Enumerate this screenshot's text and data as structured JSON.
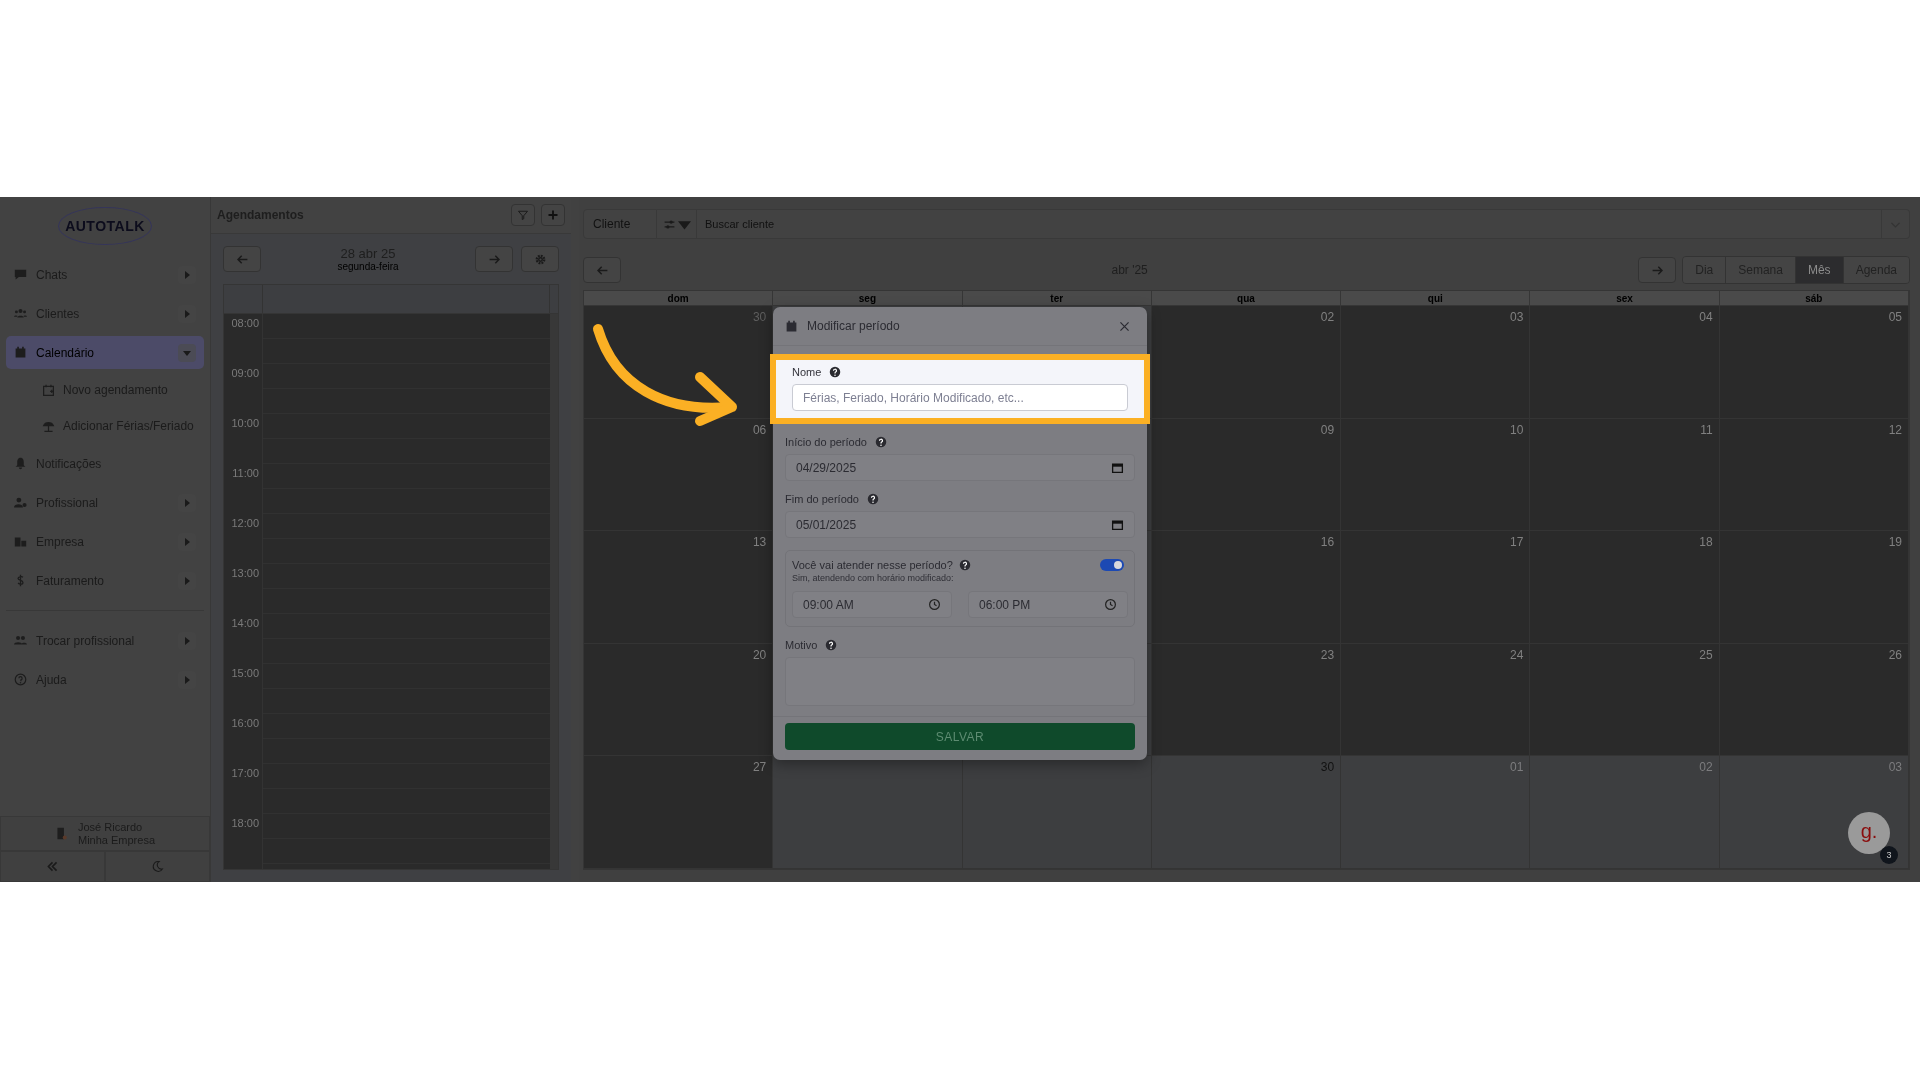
{
  "sidebar": {
    "logo": "AUTOTALK",
    "items": [
      {
        "label": "Chats",
        "kind": "group",
        "expanded": false,
        "selected": false
      },
      {
        "label": "Clientes",
        "kind": "group",
        "expanded": false,
        "selected": false
      },
      {
        "label": "Calendário",
        "kind": "group",
        "expanded": true,
        "selected": true,
        "children": [
          {
            "label": "Novo agendamento",
            "selected": false
          },
          {
            "label": "Adicionar Férias/Feriado",
            "selected": false
          }
        ]
      },
      {
        "label": "Notificações",
        "kind": "link",
        "selected": false
      },
      {
        "label": "Profissional",
        "kind": "group",
        "expanded": false,
        "selected": false
      },
      {
        "label": "Empresa",
        "kind": "group",
        "expanded": false,
        "selected": false
      },
      {
        "label": "Faturamento",
        "kind": "group",
        "expanded": false,
        "selected": false
      }
    ],
    "secondary_items": [
      {
        "label": "Trocar profissional",
        "kind": "group",
        "expanded": false,
        "selected": false
      },
      {
        "label": "Ajuda",
        "kind": "group",
        "expanded": false,
        "selected": false
      }
    ],
    "user": {
      "name": "José Ricardo",
      "company": "Minha Empresa"
    }
  },
  "schedule": {
    "title": "Agendamentos",
    "date": "28 abr 25",
    "weekday": "segunda-feira",
    "hours": [
      "08:00",
      "09:00",
      "10:00",
      "11:00",
      "12:00",
      "13:00",
      "14:00",
      "15:00",
      "16:00",
      "17:00",
      "18:00"
    ]
  },
  "calendar": {
    "search": {
      "filter": "Cliente",
      "placeholder": "Buscar cliente"
    },
    "month": "abr '25",
    "views": [
      {
        "label": "Dia",
        "selected": false
      },
      {
        "label": "Semana",
        "selected": false
      },
      {
        "label": "Mês",
        "selected": true
      },
      {
        "label": "Agenda",
        "selected": false
      }
    ],
    "weekdays": [
      "dom",
      "seg",
      "ter",
      "qua",
      "qui",
      "sex",
      "sáb"
    ],
    "weeks": [
      {
        "sun": {
          "day": "30",
          "past": true,
          "other_month": true
        },
        "wed": {
          "day": "02",
          "past": true,
          "other_month": false
        },
        "thu": {
          "day": "03",
          "past": true,
          "other_month": false
        },
        "fri": {
          "day": "04",
          "past": true,
          "other_month": false
        },
        "sat": {
          "day": "05",
          "past": true,
          "other_month": false
        }
      },
      {
        "sun": {
          "day": "06",
          "past": true,
          "other_month": false
        },
        "wed": {
          "day": "09",
          "past": true,
          "other_month": false
        },
        "thu": {
          "day": "10",
          "past": true,
          "other_month": false
        },
        "fri": {
          "day": "11",
          "past": true,
          "other_month": false
        },
        "sat": {
          "day": "12",
          "past": true,
          "other_month": false
        }
      },
      {
        "sun": {
          "day": "13",
          "past": true,
          "other_month": false
        },
        "wed": {
          "day": "16",
          "past": true,
          "other_month": false
        },
        "thu": {
          "day": "17",
          "past": true,
          "other_month": false
        },
        "fri": {
          "day": "18",
          "past": true,
          "other_month": false
        },
        "sat": {
          "day": "19",
          "past": true,
          "other_month": false
        }
      },
      {
        "sun": {
          "day": "20",
          "past": true,
          "other_month": false
        },
        "wed": {
          "day": "23",
          "past": true,
          "other_month": false
        },
        "thu": {
          "day": "24",
          "past": true,
          "other_month": false
        },
        "fri": {
          "day": "25",
          "past": true,
          "other_month": false
        },
        "sat": {
          "day": "26",
          "past": true,
          "other_month": false
        }
      },
      {
        "sun": {
          "day": "27",
          "past": true,
          "other_month": false
        },
        "mon": {
          "past": false
        },
        "tue": {
          "past": false
        },
        "wed": {
          "day": "30",
          "past": false,
          "other_month": false
        },
        "thu": {
          "day": "01",
          "past": false,
          "other_month": true
        },
        "fri": {
          "day": "02",
          "past": false,
          "other_month": true
        },
        "sat": {
          "day": "03",
          "past": false,
          "other_month": true
        }
      }
    ]
  },
  "modal": {
    "title": "Modificar período",
    "fields": [
      {
        "label": "Nome",
        "kind": "text",
        "placeholder": "Férias, Feriado, Horário Modificado, etc...",
        "highlighted": true
      },
      {
        "label": "Início do período",
        "kind": "date",
        "value": "04/29/2025",
        "highlighted": false
      },
      {
        "label": "Fim do período",
        "kind": "date",
        "value": "05/01/2025",
        "highlighted": false
      }
    ],
    "attendance": {
      "question": "Você vai atender nesse período?",
      "on": true,
      "note": "Sim, atendendo com horário modificado:",
      "start": "09:00 AM",
      "end": "06:00 PM"
    },
    "reason": {
      "label": "Motivo"
    },
    "save": "SALVAR"
  },
  "chat_widget": {
    "logo": "g.",
    "badge": "3"
  }
}
